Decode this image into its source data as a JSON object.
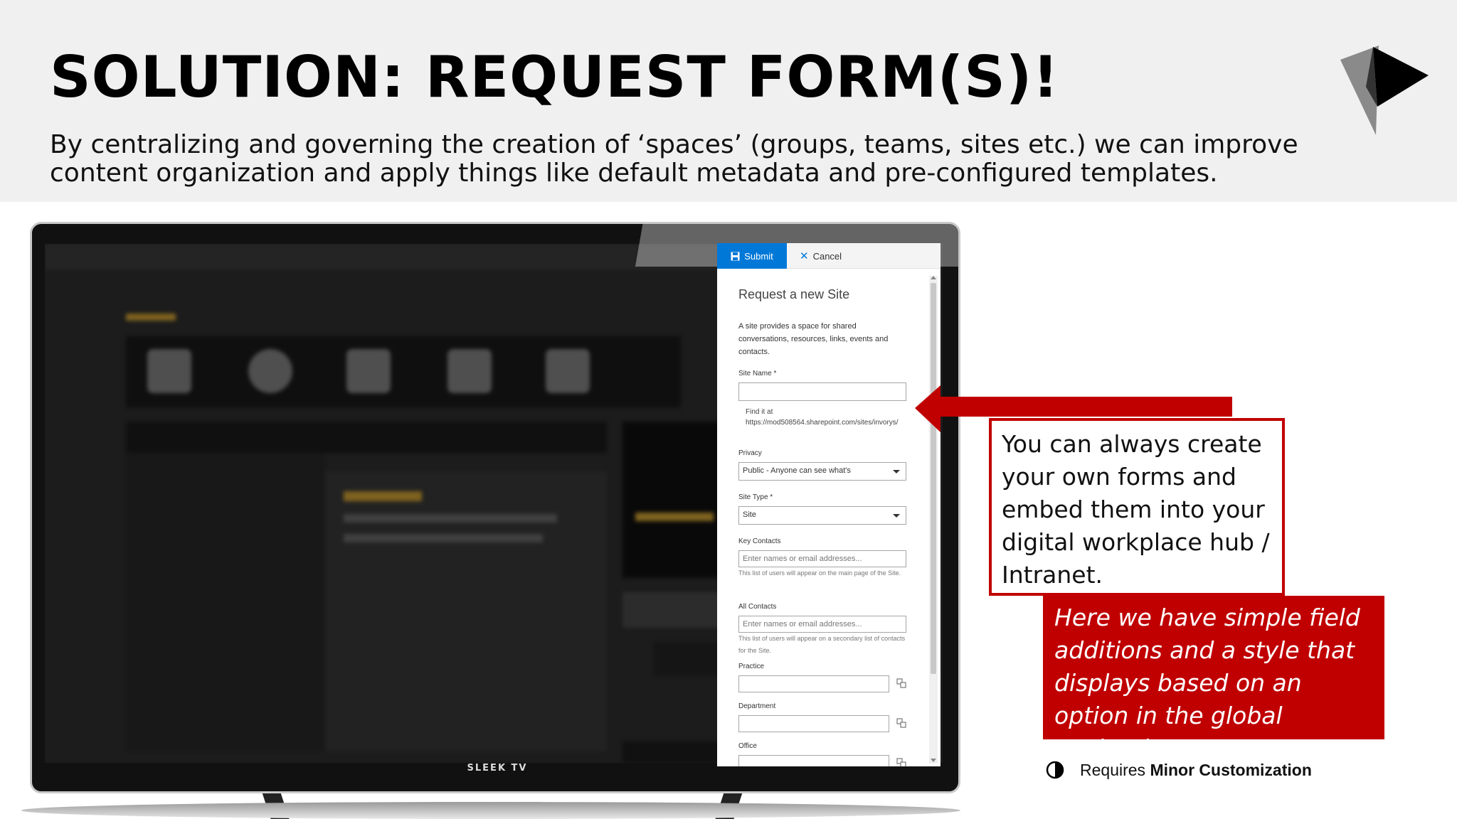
{
  "slide": {
    "title": "SOLUTION: REQUEST FORM(S)!",
    "subtitle": "By centralizing and governing the creation of ‘spaces’ (groups, teams, sites etc.) we can improve content organization and apply things like default metadata and pre-configured templates."
  },
  "tv": {
    "brand": "SLEEK TV"
  },
  "form": {
    "toolbar": {
      "submit_label": "Submit",
      "cancel_label": "Cancel"
    },
    "title": "Request a new Site",
    "description": "A site provides a space for shared conversations, resources, links, events and contacts.",
    "site_name": {
      "label": "Site Name *",
      "value": "",
      "url_hint": "Find it at https://mod508564.sharepoint.com/sites/invorys/"
    },
    "privacy": {
      "label": "Privacy",
      "selected": "Public - Anyone can see what's"
    },
    "site_type": {
      "label": "Site Type *",
      "selected": "Site"
    },
    "key_contacts": {
      "label": "Key Contacts",
      "placeholder": "Enter names or email addresses...",
      "help": "This list of users will appear on the main page of the Site."
    },
    "all_contacts": {
      "label": "All Contacts",
      "placeholder": "Enter names or email addresses...",
      "help": "This list of users will appear on a secondary list of contacts for the Site."
    },
    "practice": {
      "label": "Practice"
    },
    "department": {
      "label": "Department"
    },
    "office": {
      "label": "Office"
    }
  },
  "callouts": {
    "white_text": "You can always create your own forms and embed them into your digital workplace hub / Intranet.",
    "red_text": "Here we have simple field additions and a style that displays based on an option in the global navigation."
  },
  "requires": {
    "prefix": "Requires",
    "level": "Minor Customization",
    "icon": "half-circle-icon"
  },
  "colors": {
    "accent_red": "#c00000",
    "submit_blue": "#0078d7",
    "header_bg": "#f0f0f0"
  }
}
